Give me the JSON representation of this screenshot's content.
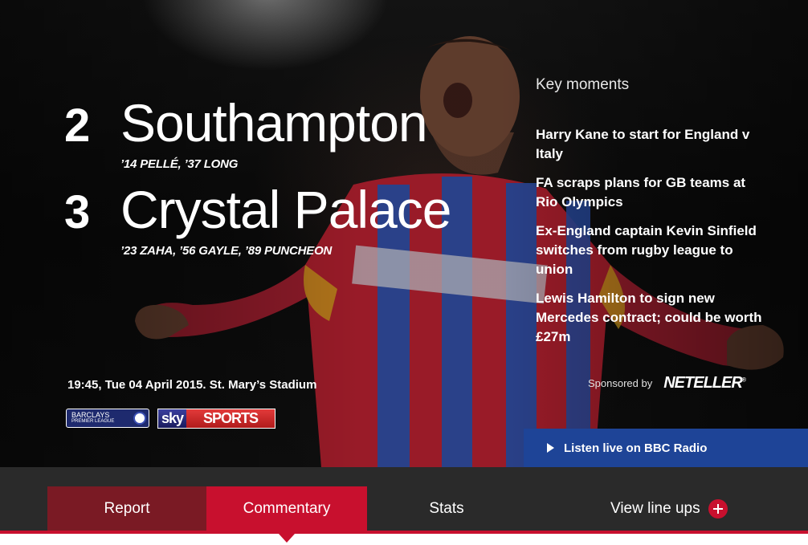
{
  "match": {
    "home": {
      "score": "2",
      "team": "Southampton",
      "scorers": "’14 PELLÉ, ’37 LONG"
    },
    "away": {
      "score": "3",
      "team": "Crystal Palace",
      "scorers": "’23 ZAHA, ’56 GAYLE, ’89 PUNCHEON"
    },
    "info": "19:45, Tue 04 April 2015. St. Mary’s Stadium"
  },
  "logos": {
    "league_main": "BARCLAYS",
    "league_sub": "PREMIER LEAGUE",
    "broadcaster_sky": "sky",
    "broadcaster_sports": "SPORTS"
  },
  "key_moments": {
    "title": "Key moments",
    "items": [
      "Harry Kane to start for England v Italy",
      "FA scraps plans for GB teams at Rio Olympics",
      "Ex-England captain Kevin Sinfield switches from rugby league to union",
      "Lewis Hamilton to sign new Mercedes contract; could be worth £27m"
    ]
  },
  "sponsor": {
    "label": "Sponsored by",
    "logo_text": "NETELLER"
  },
  "listen": {
    "label": "Listen live on BBC Radio",
    "icon": "play-icon"
  },
  "tabs": {
    "report": "Report",
    "commentary": "Commentary",
    "stats": "Stats",
    "lineups": "View line ups",
    "lineups_icon": "plus-circle-icon",
    "active": "commentary"
  },
  "colors": {
    "accent_red": "#c8102e",
    "dark_red": "#7a1a24",
    "nav_bg": "#2a2a2a",
    "radio_blue": "#1e4497"
  }
}
